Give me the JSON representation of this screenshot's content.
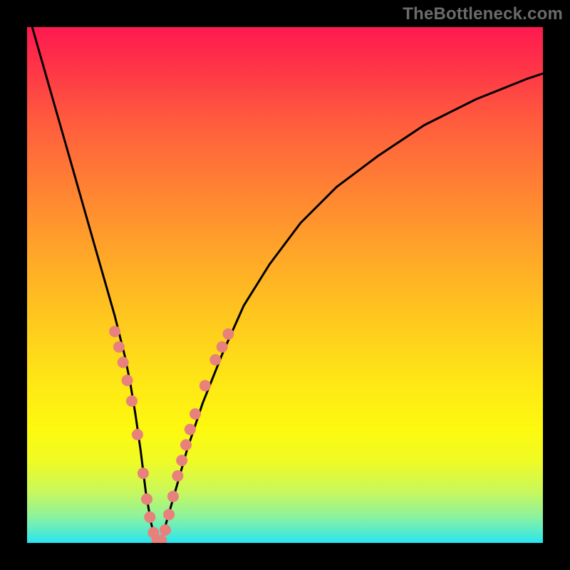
{
  "watermark": "TheBottleneck.com",
  "background": {
    "frame_color": "#000000",
    "gradient_top": "#fe1950",
    "gradient_bottom": "#26e4f2"
  },
  "chart_data": {
    "type": "line",
    "title": "",
    "xlabel": "",
    "ylabel": "",
    "xlim": [
      0,
      100
    ],
    "ylim": [
      0,
      100
    ],
    "grid": false,
    "series": [
      {
        "name": "bottleneck-curve",
        "x": [
          1,
          3,
          5,
          7,
          9,
          11,
          13,
          15,
          17,
          19,
          20,
          21,
          22,
          23,
          24,
          25,
          26,
          27,
          29,
          31,
          34,
          38,
          42,
          47,
          53,
          60,
          68,
          77,
          87,
          97,
          100
        ],
        "values": [
          100,
          93,
          86,
          79,
          72,
          65,
          58,
          51,
          44,
          36,
          31,
          25,
          18,
          10,
          4,
          0,
          0,
          4,
          11,
          18,
          27,
          37,
          46,
          54,
          62,
          69,
          75,
          81,
          86,
          90,
          91
        ]
      }
    ],
    "markers": [
      {
        "x": 17.0,
        "y": 41.0
      },
      {
        "x": 17.8,
        "y": 38.0
      },
      {
        "x": 18.6,
        "y": 35.0
      },
      {
        "x": 19.4,
        "y": 31.5
      },
      {
        "x": 20.3,
        "y": 27.5
      },
      {
        "x": 21.4,
        "y": 21.0
      },
      {
        "x": 22.5,
        "y": 13.5
      },
      {
        "x": 23.2,
        "y": 8.5
      },
      {
        "x": 23.8,
        "y": 5.0
      },
      {
        "x": 24.5,
        "y": 2.0
      },
      {
        "x": 25.2,
        "y": 0.5
      },
      {
        "x": 26.0,
        "y": 0.5
      },
      {
        "x": 26.8,
        "y": 2.5
      },
      {
        "x": 27.5,
        "y": 5.5
      },
      {
        "x": 28.3,
        "y": 9.0
      },
      {
        "x": 29.2,
        "y": 13.0
      },
      {
        "x": 30.0,
        "y": 16.0
      },
      {
        "x": 30.8,
        "y": 19.0
      },
      {
        "x": 31.6,
        "y": 22.0
      },
      {
        "x": 32.6,
        "y": 25.0
      },
      {
        "x": 34.5,
        "y": 30.5
      },
      {
        "x": 36.5,
        "y": 35.5
      },
      {
        "x": 37.8,
        "y": 38.0
      },
      {
        "x": 39.0,
        "y": 40.5
      }
    ]
  }
}
